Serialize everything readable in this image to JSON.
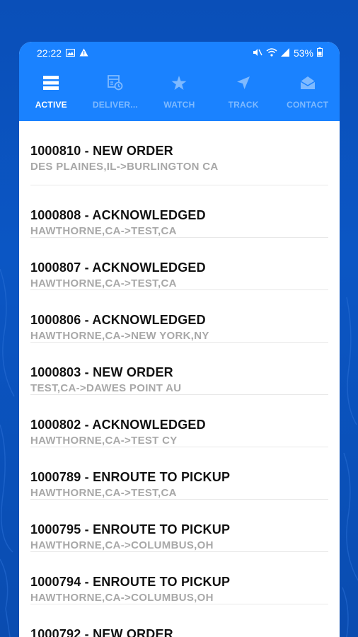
{
  "status_bar": {
    "time": "22:22",
    "battery": "53%",
    "left_icons": [
      "image-icon",
      "warning-icon"
    ],
    "right_icons": [
      "mute-icon",
      "wifi-icon",
      "signal-icon",
      "battery-icon"
    ]
  },
  "tabs": [
    {
      "label": "ACTIVE",
      "icon": "list-icon",
      "active": true
    },
    {
      "label": "DELIVER...",
      "icon": "delivered-calendar-icon",
      "active": false
    },
    {
      "label": "WATCH",
      "icon": "star-icon",
      "active": false
    },
    {
      "label": "TRACK",
      "icon": "navigation-arrow-icon",
      "active": false
    },
    {
      "label": "CONTACT",
      "icon": "envelope-icon",
      "active": false
    }
  ],
  "orders": [
    {
      "title": "1000810 - NEW ORDER",
      "route": "DES PLAINES,IL->BURLINGTON CA"
    },
    {
      "title": "1000808 - ACKNOWLEDGED",
      "route": "HAWTHORNE,CA->TEST,CA"
    },
    {
      "title": "1000807 - ACKNOWLEDGED",
      "route": "HAWTHORNE,CA->TEST,CA"
    },
    {
      "title": "1000806 - ACKNOWLEDGED",
      "route": "HAWTHORNE,CA->NEW YORK,NY"
    },
    {
      "title": "1000803 - NEW ORDER",
      "route": "TEST,CA->DAWES POINT AU"
    },
    {
      "title": "1000802 - ACKNOWLEDGED",
      "route": "HAWTHORNE,CA->TEST CY"
    },
    {
      "title": "1000789 - ENROUTE TO PICKUP",
      "route": "HAWTHORNE,CA->TEST,CA"
    },
    {
      "title": "1000795 - ENROUTE TO PICKUP",
      "route": "HAWTHORNE,CA->COLUMBUS,OH"
    },
    {
      "title": "1000794 - ENROUTE TO PICKUP",
      "route": "HAWTHORNE,CA->COLUMBUS,OH"
    },
    {
      "title": "1000792 - NEW ORDER",
      "route": ""
    }
  ],
  "colors": {
    "background": "#0b53be",
    "header": "#1a82ff",
    "active_tab": "#ffffff",
    "inactive_tab": "#7fbaff",
    "title_text": "#111111",
    "subtitle_text": "#a8a8a8"
  }
}
